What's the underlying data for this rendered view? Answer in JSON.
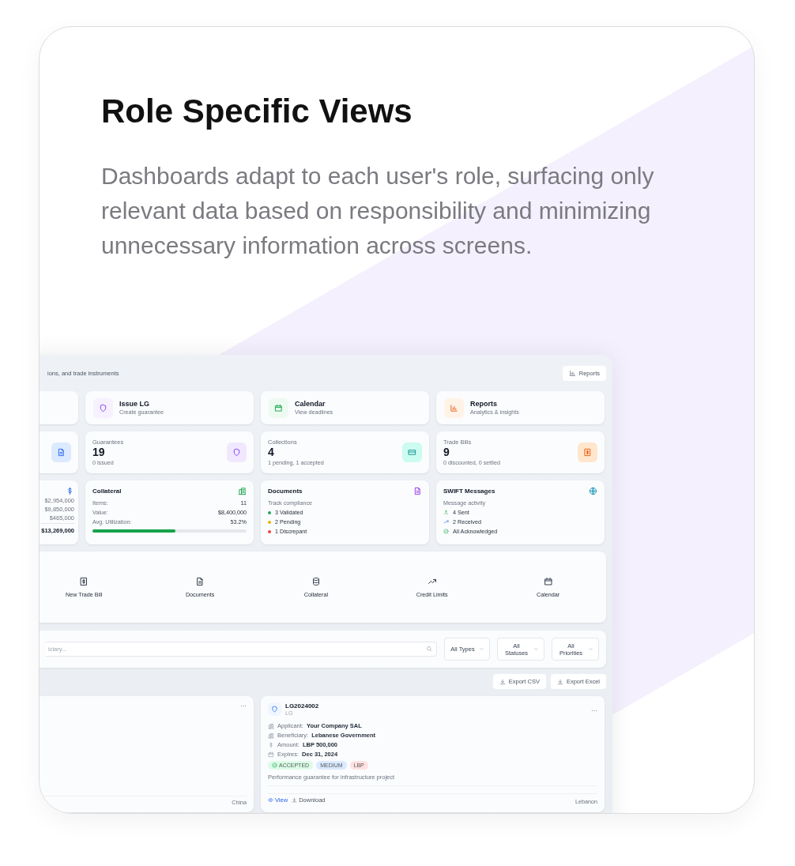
{
  "hero": {
    "title": "Role Specific Views",
    "description": "Dashboards adapt to each user's role, surfacing only relevant data based on responsibility and minimizing unnecessary information across screens."
  },
  "dashboard": {
    "subtitle": "ions, and trade instruments",
    "reports_button": "Reports",
    "actions": [
      {
        "title": "Issue LG",
        "subtitle": "Create guarantee"
      },
      {
        "title": "Calendar",
        "subtitle": "View deadlines"
      },
      {
        "title": "Reports",
        "subtitle": "Analytics & insights"
      }
    ],
    "stats": [
      {
        "label": "Guarantees",
        "value": "19",
        "note": "0 issued"
      },
      {
        "label": "Collections",
        "value": "4",
        "note": "1 pending, 1 accepted"
      },
      {
        "label": "Trade Bills",
        "value": "9",
        "note": "0 discounted, 0 settled"
      }
    ],
    "amounts": [
      "$2,954,000",
      "$9,850,000",
      "$465,000"
    ],
    "total": "$13,269,000",
    "collateral": {
      "title": "Collateral",
      "rows": [
        {
          "label": "Items:",
          "value": "11"
        },
        {
          "label": "Value:",
          "value": "$8,400,000"
        },
        {
          "label": "Avg. Utilization:",
          "value": "53.2%"
        }
      ],
      "level": 0.54
    },
    "documents": {
      "title": "Documents",
      "subtitle": "Track compliance",
      "items": [
        {
          "label": "3 Validated",
          "color": "#22a55a"
        },
        {
          "label": "2 Pending",
          "color": "#eab308"
        },
        {
          "label": "1 Discrepant",
          "color": "#ef4444"
        }
      ]
    },
    "swift": {
      "title": "SWIFT Messages",
      "subtitle": "Message activity",
      "items": [
        "4 Sent",
        "2 Received",
        "All Acknowledged"
      ]
    },
    "quick_actions": [
      "New Trade Bill",
      "Documents",
      "Collateral",
      "Credit Limits",
      "Calendar"
    ],
    "search": {
      "placeholder": "iciary..."
    },
    "filters": [
      "All Types",
      "All Statuses",
      "All Priorities"
    ],
    "exports": [
      "Export CSV",
      "Export Excel"
    ],
    "results": [
      {
        "menu": "···",
        "country": "China"
      },
      {
        "id": "LG2024002",
        "type": "LG",
        "menu": "···",
        "fields": [
          {
            "label": "Applicant:",
            "value": "Your Company SAL"
          },
          {
            "label": "Beneficiary:",
            "value": "Lebanese Government"
          },
          {
            "label": "Amount:",
            "value": "LBP 500,000"
          },
          {
            "label": "Expires:",
            "value": "Dec 31, 2024"
          }
        ],
        "tags": [
          {
            "kind": "status",
            "label": "ACCEPTED",
            "color": "#dcfce7"
          },
          {
            "kind": "label",
            "label": "MEDIUM",
            "color": "#dbeafe"
          },
          {
            "kind": "label",
            "label": "LBP",
            "color": "#fee2e2"
          }
        ],
        "description": "Performance guarantee for infrastructure project",
        "links": [
          "View",
          "Download"
        ],
        "country": "Lebanon"
      }
    ]
  }
}
